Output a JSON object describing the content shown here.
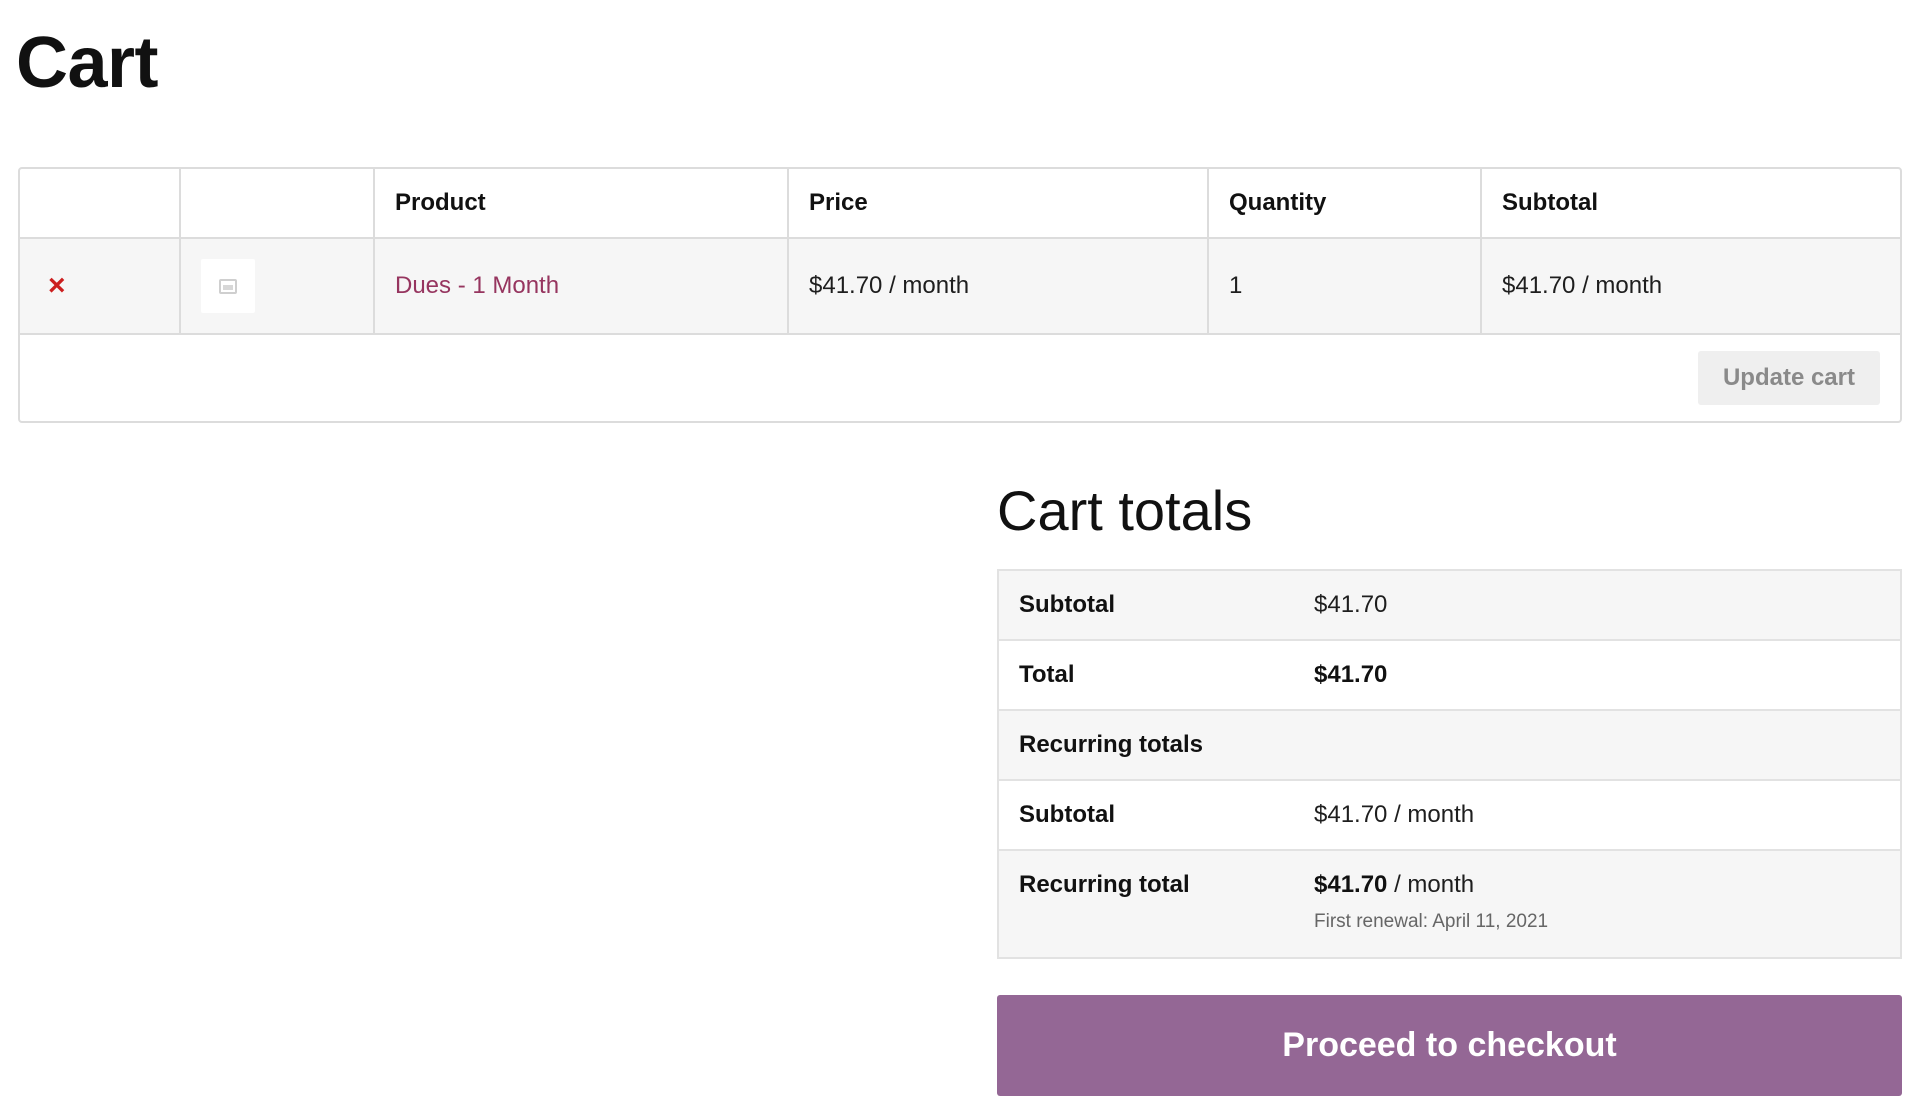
{
  "page": {
    "title": "Cart"
  },
  "cart_table": {
    "headers": {
      "product": "Product",
      "price": "Price",
      "quantity": "Quantity",
      "subtotal": "Subtotal"
    },
    "items": [
      {
        "remove_glyph": "×",
        "thumbnail_icon": "image-placeholder-icon",
        "product": "Dues - 1 Month",
        "price": "$41.70 / month",
        "quantity": "1",
        "subtotal": "$41.70 / month"
      }
    ],
    "update_label": "Update cart"
  },
  "totals": {
    "title": "Cart totals",
    "subtotal_label": "Subtotal",
    "subtotal_value": "$41.70",
    "total_label": "Total",
    "total_value": "$41.70",
    "recurring_heading": "Recurring totals",
    "recurring_subtotal_label": "Subtotal",
    "recurring_subtotal_value": "$41.70 / month",
    "recurring_total_label": "Recurring total",
    "recurring_total_amount": "$41.70",
    "recurring_total_period": " / month",
    "first_renewal": "First renewal: April 11, 2021"
  },
  "checkout": {
    "label": "Proceed to checkout"
  },
  "colors": {
    "accent": "#946795",
    "link": "#96355f",
    "remove": "#cc1f1f"
  }
}
